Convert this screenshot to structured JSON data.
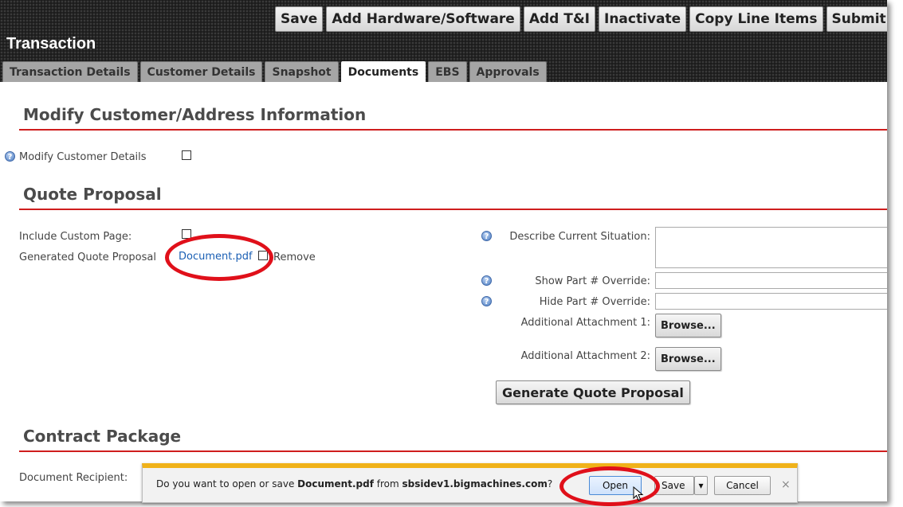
{
  "header": {
    "title": "Transaction",
    "actions": [
      "Save",
      "Add Hardware/Software",
      "Add T&I",
      "Inactivate",
      "Copy Line Items",
      "Submit for"
    ],
    "tabs": [
      "Transaction Details",
      "Customer Details",
      "Snapshot",
      "Documents",
      "EBS",
      "Approvals"
    ],
    "active_tab": "Documents"
  },
  "modify_section": {
    "title": "Modify Customer/Address Information",
    "modify_customer_details_label": "Modify Customer Details"
  },
  "quote_section": {
    "title": "Quote Proposal",
    "include_custom_page_label": "Include Custom Page:",
    "generated_quote_label": "Generated Quote Proposal",
    "document_link": "Document.pdf",
    "remove_label": "Remove",
    "describe_label": "Describe Current Situation:",
    "show_part_label": "Show Part # Override:",
    "hide_part_label": "Hide Part # Override:",
    "attachment1_label": "Additional Attachment 1:",
    "attachment2_label": "Additional Attachment 2:",
    "browse_label": "Browse...",
    "generate_button": "Generate Quote Proposal"
  },
  "contract_section": {
    "title": "Contract Package",
    "document_recipient_label": "Document Recipient:"
  },
  "download_bar": {
    "prefix": "Do you want to open or save ",
    "filename": "Document.pdf",
    "middle": " from ",
    "site": "sbsidev1.bigmachines.com",
    "suffix": "?",
    "open": "Open",
    "save": "Save",
    "cancel": "Cancel",
    "close": "×"
  },
  "colors": {
    "accent_red": "#cf1d1d",
    "annotation_red": "#e0101a",
    "link_blue": "#1a5fb4",
    "download_bar_top": "#f0b21a"
  }
}
